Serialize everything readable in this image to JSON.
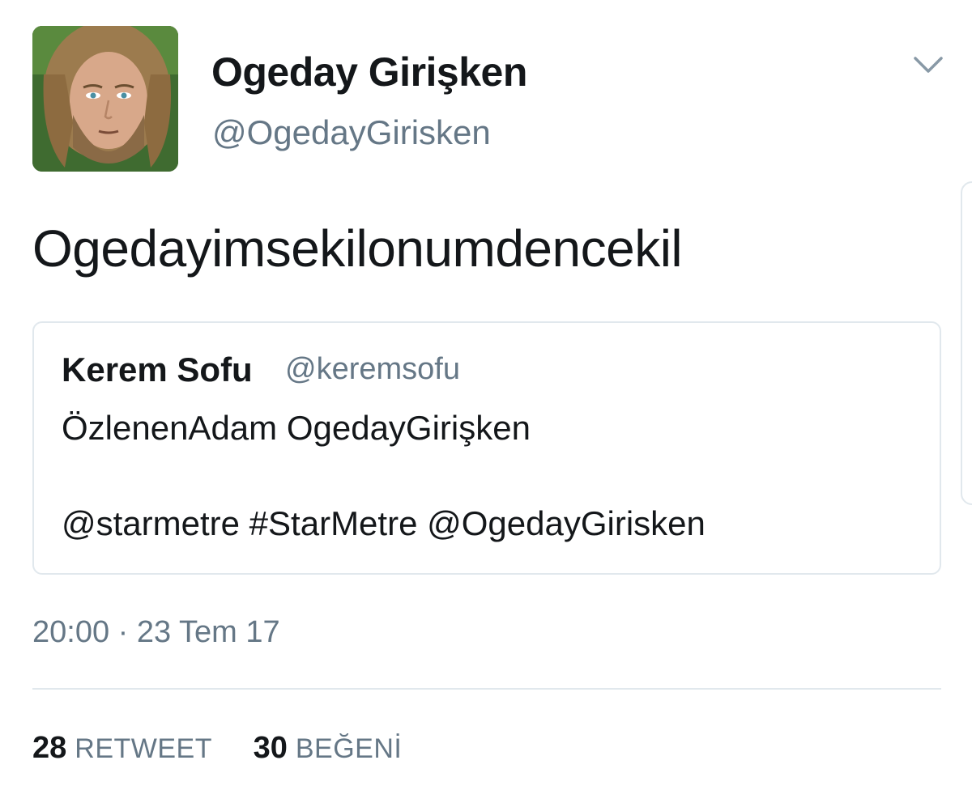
{
  "author": {
    "display_name": "Ogeday Girişken",
    "handle": "@OgedayGirisken"
  },
  "tweet": {
    "text": "Ogedayimsekilonumdencekil",
    "timestamp": "20:00 · 23 Tem 17"
  },
  "quoted_tweet": {
    "display_name": "Kerem Sofu",
    "handle": "@keremsofu",
    "line1": "ÖzlenenAdam OgedayGirişken",
    "line2": "@starmetre #StarMetre @OgedayGirisken"
  },
  "stats": {
    "retweets_count": "28",
    "retweets_label": "RETWEET",
    "likes_count": "30",
    "likes_label": "BEĞENİ"
  },
  "icons": {
    "menu": "chevron-down-icon"
  },
  "colors": {
    "text": "#14171a",
    "secondary": "#657786",
    "border": "#e1e8ed"
  }
}
